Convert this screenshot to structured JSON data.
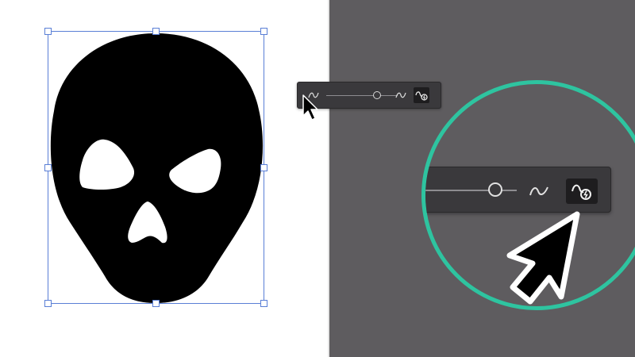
{
  "app": {
    "left_canvas_bg": "#ffffff",
    "right_canvas_bg": "#5e5c5f",
    "highlight_color": "#2ec4a0",
    "selection_color": "#5a7fd6"
  },
  "artwork": {
    "name": "skull",
    "fill": "#000000",
    "selected": true
  },
  "smoothing_toolbar": {
    "icons": [
      "smooth-curve-icon",
      "smooth-curve-icon",
      "auto-smooth-icon"
    ],
    "slider_level_percent": 66,
    "active_tool": "auto-smooth"
  },
  "callout": {
    "description_icons": [
      "smooth-curve-icon",
      "auto-smooth-icon",
      "cursor-icon"
    ]
  }
}
